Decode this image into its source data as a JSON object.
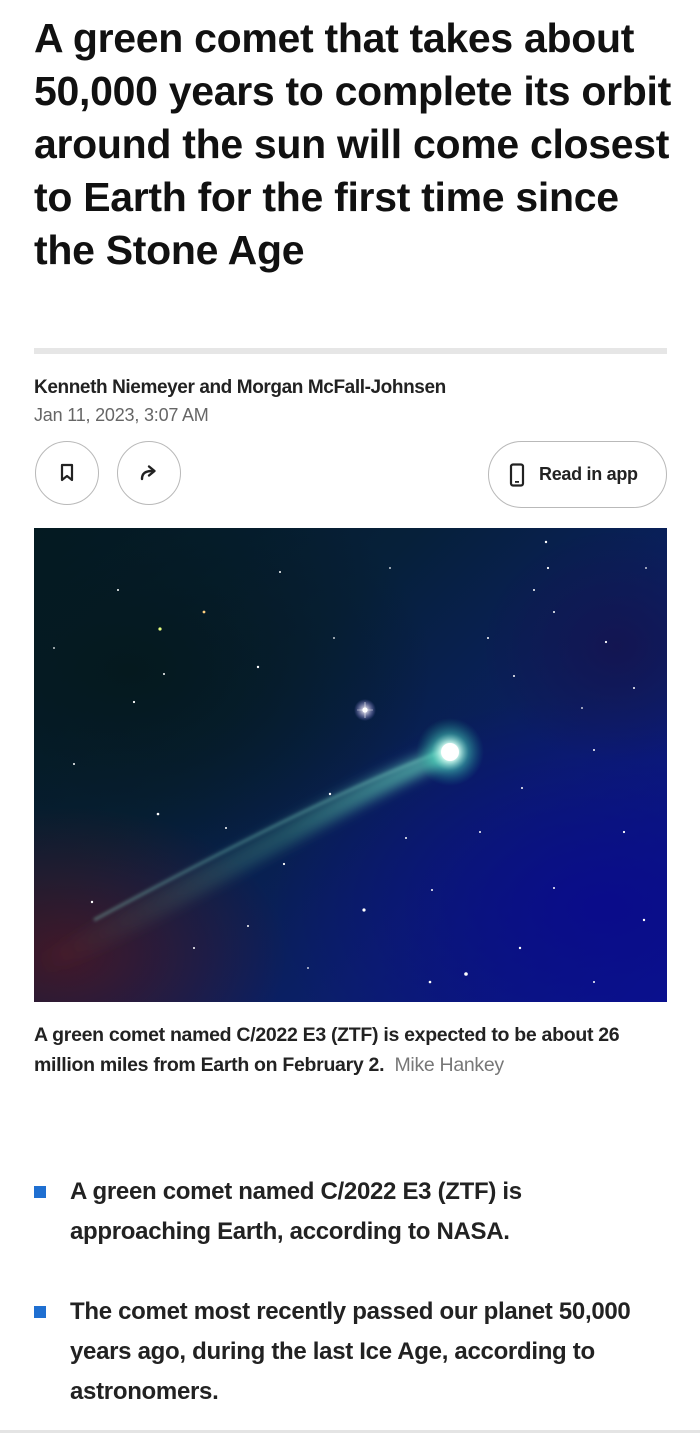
{
  "article": {
    "headline": "A green comet that takes about 50,000 years to complete its orbit around the sun will come closest to Earth for the first time since the Stone Age",
    "authors": "Kenneth Niemeyer and Morgan McFall-Johnsen",
    "date": "Jan 11, 2023, 3:07 AM"
  },
  "actions": {
    "bookmark_icon": "bookmark-icon",
    "share_icon": "share-arrow-icon",
    "read_in_app_icon": "phone-icon",
    "read_in_app_label": "Read in app"
  },
  "image": {
    "subject": "comet-photo",
    "caption": "A green comet named C/2022 E3 (ZTF) is expected to be about 26 million miles from Earth on February 2.",
    "credit": "Mike Hankey"
  },
  "key_points": [
    "A green comet named C/2022 E3 (ZTF) is approaching Earth, according to NASA.",
    "The comet most recently passed our planet 50,000 years ago, during the last Ice Age, according to astronomers."
  ],
  "colors": {
    "bullet_accent": "#1f6fd1",
    "text_primary": "#111111",
    "text_secondary": "#666666",
    "button_border": "#b9b9b9"
  }
}
